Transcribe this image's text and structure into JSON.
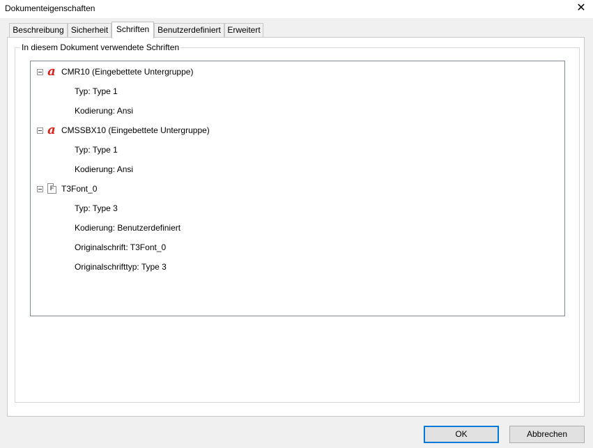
{
  "window": {
    "title": "Dokumenteigenschaften",
    "close_glyph": "✕"
  },
  "tabs": [
    {
      "label": "Beschreibung"
    },
    {
      "label": "Sicherheit"
    },
    {
      "label": "Schriften",
      "active": true
    },
    {
      "label": "Benutzerdefiniert"
    },
    {
      "label": "Erweitert"
    }
  ],
  "fonts_group": {
    "label": "In diesem Dokument verwendete Schriften",
    "fonts": [
      {
        "name": "CMR10 (Eingebettete Untergruppe)",
        "icon": "acrobat-font-icon",
        "details": [
          "Typ: Type 1",
          "Kodierung: Ansi"
        ]
      },
      {
        "name": "CMSSBX10 (Eingebettete Untergruppe)",
        "icon": "acrobat-font-icon",
        "details": [
          "Typ: Type 1",
          "Kodierung: Ansi"
        ]
      },
      {
        "name": "T3Font_0",
        "icon": "type3-font-icon",
        "icon_glyph": "F",
        "details": [
          "Typ: Type 3",
          "Kodierung: Benutzerdefiniert",
          "Originalschrift: T3Font_0",
          "Originalschrifttyp: Type 3"
        ]
      }
    ]
  },
  "buttons": {
    "ok": "OK",
    "cancel": "Abbrechen"
  },
  "colors": {
    "acrobat_icon": "#d8231f",
    "default_button_border": "#0078d7"
  }
}
